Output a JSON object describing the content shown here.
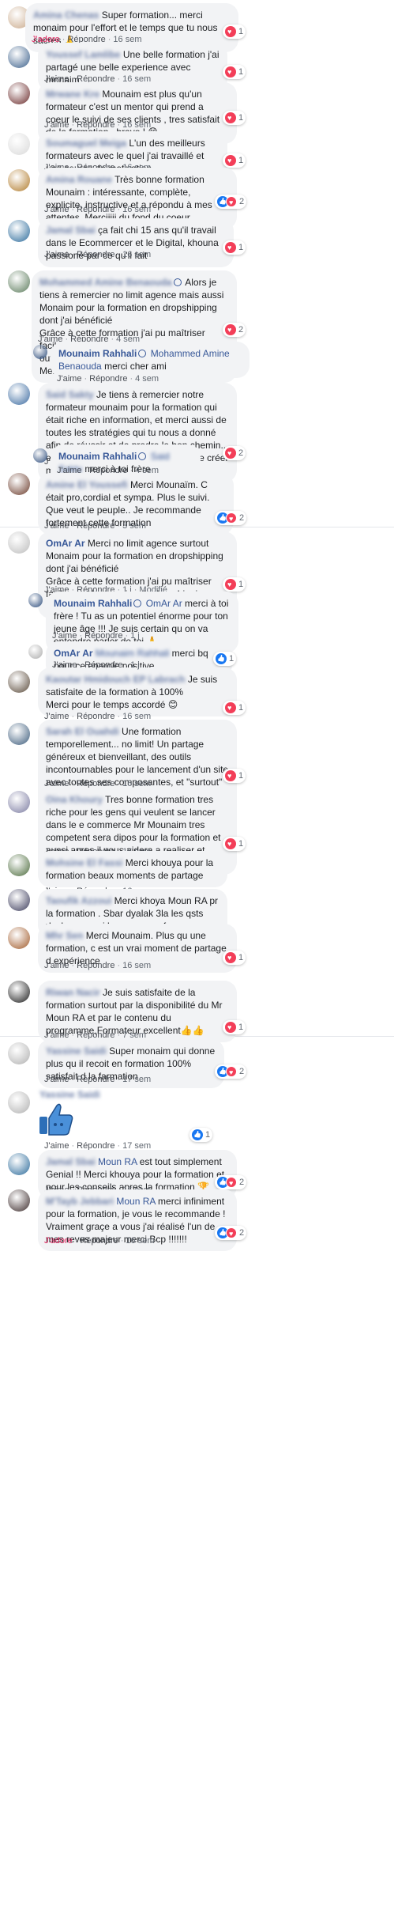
{
  "labels": {
    "like": "J'aime",
    "loved": "J'adore",
    "reply": "Répondre",
    "modified": "Modifié",
    "sep": "·"
  },
  "colors": {
    "link": "#385898",
    "love": "#e0245e",
    "bubble": "#f2f3f5",
    "heart": "#f33e58",
    "like": "#1877f2"
  },
  "comments": [
    {
      "author": "Amina Chenas",
      "text": "Super formation... merci monaim pour l'effort et le temps que tu nous sacres 🙏",
      "action": "J'adore",
      "time": "16 sem",
      "react": {
        "icons": [
          "heart"
        ],
        "count": "1"
      }
    },
    {
      "author": "Youssef Lamlibe",
      "text": "Une belle formation j'ai partagé une belle experience avec monaim",
      "action": "J'aime",
      "time": "16 sem",
      "react": {
        "icons": [
          "heart"
        ],
        "count": "1"
      }
    },
    {
      "author": "Mrwane Kre",
      "text": "Mounaim est plus qu'un formateur c'est un mentor qui prend a coeur le suivi de ses clients , tres satisfait de la formation , bravo ! 😊",
      "action": "J'aime",
      "time": "16 sem",
      "react": {
        "icons": [
          "heart"
        ],
        "count": "1"
      }
    },
    {
      "author": "Soumaguel Meiga",
      "text": "L'un des meilleurs formateurs avec le quel j'ai travaillé et une source de motivation",
      "action": "J'aime",
      "time": "16 sem",
      "react": {
        "icons": [
          "heart"
        ],
        "count": "1"
      }
    },
    {
      "author": "Amina Rouane",
      "text": "Très bonne formation Mounaim : intéressante, complète, explicite, instructive et a répondu à mes attentes. Merciiiii du fond du coeur",
      "action": "J'aime",
      "time": "16 sem",
      "react": {
        "icons": [
          "like",
          "heart"
        ],
        "count": "2"
      }
    },
    {
      "author": "Jamal Sbai",
      "text": "ça fait chi 15 ans qu'il travail dans le Ecommercer et le Digital, khouna passioné par ce qu'il fait",
      "action": "J'aime",
      "time": "16 sem",
      "react": {
        "icons": [
          "heart"
        ],
        "count": "1"
      }
    },
    {
      "author": "Mohammed Amine Benaouda",
      "text": "Alors je tiens à remercier no limit agence mais aussi Monaim pour la formation en dropshipping dont j'ai bénéficié\nGrâce à cette formation j'ai pu maîtriser facilement et rapidement les règles et les outils nécessaires pour réussir ce Buisness\nMerci pour tout",
      "action": "J'aime",
      "time": "4 sem",
      "react": {
        "icons": [
          "heart"
        ],
        "count": "2"
      }
    },
    {
      "author": "Mounaim Rahhali",
      "mention": "Mohammed Amine Benaouda",
      "text": "merci cher ami",
      "action": "J'aime",
      "time": "4 sem"
    },
    {
      "author": "Said Sakty",
      "text": "Je tiens à remercier notre formateur mounaim pour la formation qui était riche en information, et merci aussi de toutes les stratégies qui tu nous a donné afin de réussir et de predre le bon chemin.. et aussi de votre encadrement afin de créer mon propre sotre step by step",
      "action": "J'aime",
      "time": "4 sem",
      "react": {
        "icons": [
          "heart"
        ],
        "count": "2"
      }
    },
    {
      "author": "Mounaim Rahhali",
      "mention": "Said Sakty",
      "text": "merci à toi frère",
      "action": "J'aime",
      "time": "4 sem"
    },
    {
      "author": "Amine El Youssefi",
      "text": "Merci Mounaïm. C était pro,cordial et sympa. Plus le suivi. Que veut le peuple.. Je recommande fortement cette formation",
      "action": "J'aime",
      "time": "3 sem",
      "react": {
        "icons": [
          "like",
          "heart"
        ],
        "count": "2"
      }
    },
    {
      "author": "OmAr Ar",
      "text": "Merci no limit agence surtout Monaim pour la formation en dropshipping dont j'ai bénéficié\nGrâce à cette formation j'ai pu maîtriser facilement le domaine de dropshipping\nMerci pour tout",
      "action": "J'aime",
      "time": "1 j",
      "modified": "Modifié",
      "react": {
        "icons": [
          "heart"
        ],
        "count": "1"
      }
    },
    {
      "author": "Mounaim Rahhali",
      "mention": "OmAr Ar",
      "text": "merci à toi frère ! Tu as un potentiel énorme pour ton jeune âge !!! Je suis certain qu on va entendre parler de toi 🙏",
      "action": "J'aime",
      "time": "1 j"
    },
    {
      "author": "OmAr Ar",
      "mention": "Mounaim Rahhali",
      "text": "merci bq pour ce energie positive",
      "action": "J'aime",
      "time": "1 j",
      "react": {
        "icons": [
          "like"
        ],
        "count": "1"
      }
    },
    {
      "author": "Kaoutar Hmidouch EP Labrach",
      "text": "Je suis satisfaite de la formation à 100%\nMerci pour le temps accordé 😊",
      "action": "J'aime",
      "time": "16 sem",
      "react": {
        "icons": [
          "heart"
        ],
        "count": "1"
      }
    },
    {
      "author": "Sarah El Ouahdi",
      "text": "Une formation temporellement... no limit! Un partage généreux et bienveillant, des outils incontournables pour le lancement d'un site avec toutes ses composantes, et \"surtout\" un avis aiguisé sur toutes vos ambiguités. BREF, ne vous posez pas de question et allez y!",
      "action": "J'aime",
      "time": "16 sem",
      "react": {
        "icons": [
          "heart"
        ],
        "count": "1"
      }
    },
    {
      "author": "Oina Khoury",
      "text": "Tres bonne formation tres riche pour les gens qui veulent se lancer dans le e commerce Mr Mounaim tres competent sera dipos pour la formation et aussi apres il vous aidera a realiser et creer vos site bon courage.😍😍😍",
      "action": "J'aime",
      "time": "16 sem",
      "react": {
        "icons": [
          "heart"
        ],
        "count": "1"
      }
    },
    {
      "author": "Mohsine El Fassi",
      "text": "Merci khouya pour la formation beaux moments de partage",
      "action": "J'aime",
      "time": "16 sem"
    },
    {
      "author": "Taoufik Azzoui",
      "text": "Merci khoya Moun RA pr la formation . Sbar dyalak 3la les qsts dyalana merci bezzzzaaaaaf",
      "action": "J'aime",
      "time": "16 sem"
    },
    {
      "author": "Mhr Sen",
      "text": "Merci Mounaim. Plus qu une formation, c est un vrai moment de partage d expérience",
      "action": "J'aime",
      "time": "16 sem",
      "react": {
        "icons": [
          "heart"
        ],
        "count": "1"
      }
    },
    {
      "author": "Riwan Nacir",
      "text": "Je suis satisfaite de la formation surtout par la disponibilité du Mr Moun RA et par le contenu du programme,Formateur excellent👍👍",
      "action": "J'aime",
      "time": "7 sem",
      "react": {
        "icons": [
          "heart"
        ],
        "count": "1"
      }
    },
    {
      "author": "Yassine Saidi",
      "text": "Super monaim qui donne plus qu il recoit en formation 100% satisfait d la farmation",
      "action": "J'aime",
      "time": "17 sem",
      "react": {
        "icons": [
          "like",
          "heart"
        ],
        "count": "2"
      }
    },
    {
      "author": "Yassine Saidi",
      "text": "",
      "sticker": "thumbs-up-sticker",
      "action": "J'aime",
      "time": "17 sem",
      "react": {
        "icons": [
          "like"
        ],
        "count": "1"
      }
    },
    {
      "author": "Jamal Sbai",
      "mention": "Moun RA",
      "text": "est tout simplement Genial !! Merci khouya pour la formation et pour les conseils apres la formation 🏆",
      "action": "J'aime",
      "time": "16 sem",
      "react": {
        "icons": [
          "like",
          "heart"
        ],
        "count": "2"
      }
    },
    {
      "author": "M'Tayb Jebbari",
      "mention": "Moun RA",
      "text": "merci infiniment pour la formation, je vous le recommande ! Vraiment graçe a vous j'ai réalisé l'un de mes reves majeur merci Bcp !!!!!!!",
      "action": "J'adore",
      "time": "16 sem",
      "react": {
        "icons": [
          "like",
          "heart"
        ],
        "count": "2"
      }
    }
  ]
}
